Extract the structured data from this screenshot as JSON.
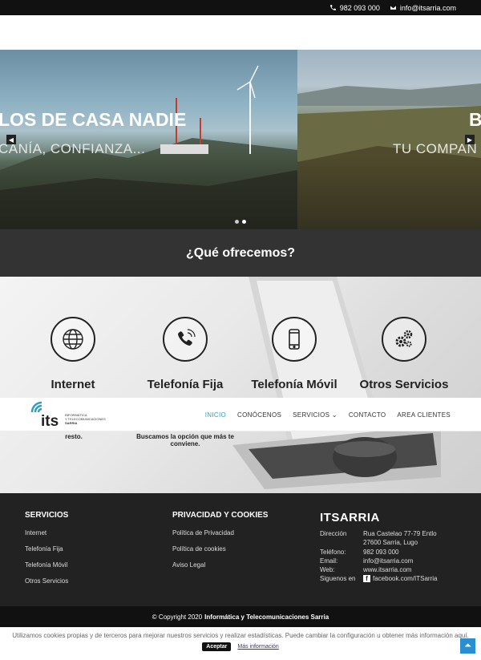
{
  "topbar": {
    "phone": "982 093 000",
    "email": "info@itsarria.com",
    "phone_icon": "phone-icon",
    "email_icon": "envelope-icon"
  },
  "slider": {
    "slide1_title": "LOS DE CASA NADIE",
    "slide1_sub": "CANÍA, CONFIANZA...",
    "slide2_title": "B",
    "slide2_sub": "TU COMPAÑ"
  },
  "offer": {
    "title": "¿Qué ofrecemos?"
  },
  "services": [
    {
      "label": "Internet",
      "icon": "globe-icon"
    },
    {
      "label": "Telefonía Fija",
      "icon": "phone-icon"
    },
    {
      "label": "Telefonía Móvil",
      "icon": "mobile-icon"
    },
    {
      "label": "Otros Servicios",
      "icon": "gears-icon"
    }
  ],
  "services_text": {
    "col1": "resto.",
    "col2": "Buscamos la opción que más te conviene."
  },
  "nav": {
    "logo_line1": "INFORMÁTICA",
    "logo_line2": "Y TELECOMUNICACIONES",
    "logo_line3": "SARRIA",
    "items": [
      "INICIO",
      "CONÓCENOS",
      "SERVICIOS",
      "CONTACTO",
      "AREA CLIENTES"
    ]
  },
  "footer": {
    "col1": {
      "heading": "SERVICIOS",
      "links": [
        "Internet",
        "Telefonía Fija",
        "Telefonía Móvil",
        "Otros Servicios"
      ]
    },
    "col2": {
      "heading": "PRIVACIDAD Y COOKIES",
      "links": [
        "Política de Privacidad",
        "Política de cookies",
        "Aviso Legal"
      ]
    },
    "col3": {
      "brand": "ITSARRIA",
      "address_label": "Dirección",
      "address_line1": "Rua Castelao 77-79 Entlo",
      "address_line2": "27600 Sarria, Lugo",
      "phone_label": "Teléfono:",
      "phone": "982 093 000",
      "email_label": "Email:",
      "email": "info@itsarria.com",
      "web_label": "Web:",
      "web": "www.itsarria.com",
      "social_label": "Siguenos en",
      "facebook": "facebook.com/ITSarria"
    }
  },
  "copyright": {
    "prefix": "© Copyright 2020",
    "company": "Informática y Telecomunicaciones Sarria"
  },
  "cookies": {
    "text": "Utilizamos cookies propias y de terceros para mejorar nuestros servicios y realizar estadísticas. Puede cambiar la configuración u obtener más información aquí.",
    "accept": "Aceptar",
    "more": "Más información"
  },
  "colors": {
    "accent": "#2aa0c9",
    "footer_bg": "#222222",
    "band_bg": "#333333",
    "totop_bg": "#2a8fd0"
  }
}
